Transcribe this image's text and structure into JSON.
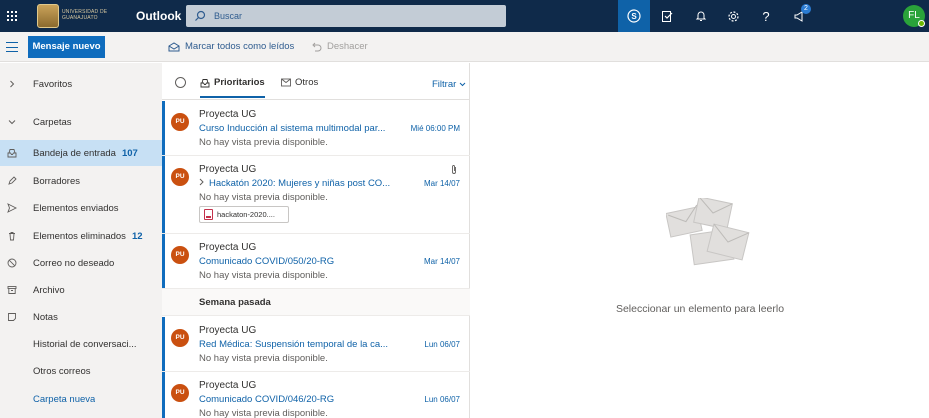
{
  "header": {
    "logo_text": "UNIVERSIDAD DE GUANAJUATO",
    "app_title": "Outlook",
    "search_placeholder": "Buscar",
    "notification_badge": "2",
    "avatar_initials": "FL"
  },
  "command_bar": {
    "new_message": "Mensaje nuevo",
    "mark_all_read": "Marcar todos como leídos",
    "undo": "Deshacer"
  },
  "nav": {
    "favoritos": "Favoritos",
    "carpetas": "Carpetas",
    "items": [
      {
        "label": "Bandeja de entrada",
        "count": "107",
        "icon": "inbox-icon"
      },
      {
        "label": "Borradores",
        "count": "",
        "icon": "pencil-icon"
      },
      {
        "label": "Elementos enviados",
        "count": "",
        "icon": "send-icon"
      },
      {
        "label": "Elementos eliminados",
        "count": "12",
        "icon": "trash-icon"
      },
      {
        "label": "Correo no deseado",
        "count": "",
        "icon": "blocked-icon"
      },
      {
        "label": "Archivo",
        "count": "",
        "icon": "archive-icon"
      },
      {
        "label": "Notas",
        "count": "",
        "icon": "note-icon"
      },
      {
        "label": "Historial de conversaci...",
        "count": "",
        "icon": ""
      },
      {
        "label": "Otros correos",
        "count": "",
        "icon": ""
      },
      {
        "label": "Carpeta nueva",
        "count": "",
        "icon": ""
      }
    ]
  },
  "list": {
    "tab_focused": "Prioritarios",
    "tab_other": "Otros",
    "filter": "Filtrar",
    "week_separator": "Semana pasada",
    "messages": [
      {
        "initials": "PU",
        "sender": "Proyecta UG",
        "subject": "Curso Inducción al sistema multimodal par...",
        "date": "Mié 06:00 PM",
        "preview": "No hay vista previa disponible."
      },
      {
        "initials": "PU",
        "sender": "Proyecta UG",
        "subject": "Hackatón 2020: Mujeres y niñas post CO...",
        "date": "Mar 14/07",
        "preview": "No hay vista previa disponible.",
        "attachment": "hackaton-2020...."
      },
      {
        "initials": "PU",
        "sender": "Proyecta UG",
        "subject": "Comunicado COVID/050/20-RG",
        "date": "Mar 14/07",
        "preview": "No hay vista previa disponible."
      },
      {
        "initials": "PU",
        "sender": "Proyecta UG",
        "subject": "Red Médica: Suspensión temporal de la ca...",
        "date": "Lun 06/07",
        "preview": "No hay vista previa disponible."
      },
      {
        "initials": "PU",
        "sender": "Proyecta UG",
        "subject": "Comunicado COVID/046/20-RG",
        "date": "Lun 06/07",
        "preview": "No hay vista previa disponible."
      }
    ]
  },
  "reading": {
    "empty_text": "Seleccionar un elemento para leerlo"
  },
  "colors": {
    "topbar": "#0f2a4a",
    "accent": "#0f6cbd",
    "avatar_sender": "#ca5010",
    "user_avatar": "#2aa33a"
  }
}
